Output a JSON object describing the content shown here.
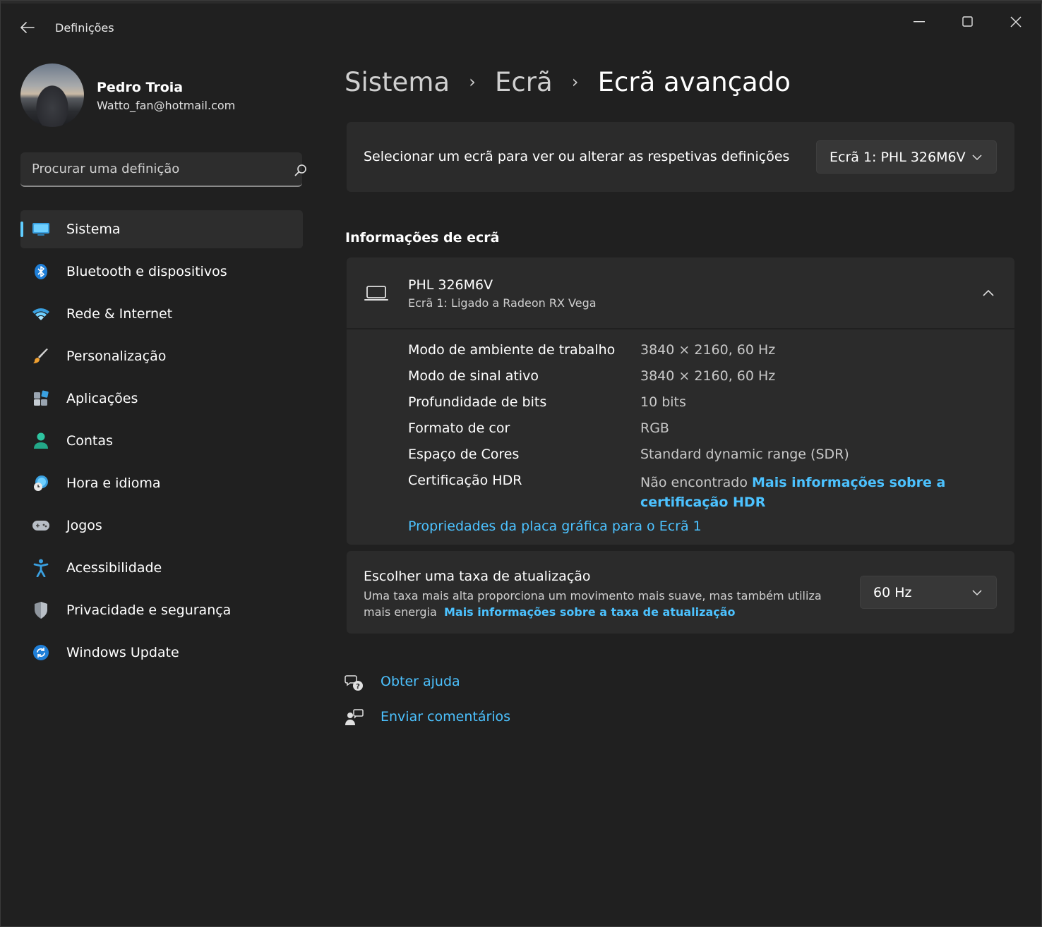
{
  "window": {
    "title": "Definições"
  },
  "profile": {
    "name": "Pedro Troia",
    "email": "Watto_fan@hotmail.com"
  },
  "search": {
    "placeholder": "Procurar uma definição"
  },
  "sidebar": {
    "items": [
      {
        "label": "Sistema",
        "icon": "monitor-icon",
        "active": true
      },
      {
        "label": "Bluetooth e dispositivos",
        "icon": "bluetooth-icon"
      },
      {
        "label": "Rede & Internet",
        "icon": "wifi-icon"
      },
      {
        "label": "Personalização",
        "icon": "brush-icon"
      },
      {
        "label": "Aplicações",
        "icon": "apps-icon"
      },
      {
        "label": "Contas",
        "icon": "person-icon"
      },
      {
        "label": "Hora e idioma",
        "icon": "clock-globe-icon"
      },
      {
        "label": "Jogos",
        "icon": "gamepad-icon"
      },
      {
        "label": "Acessibilidade",
        "icon": "accessibility-icon"
      },
      {
        "label": "Privacidade e segurança",
        "icon": "shield-icon"
      },
      {
        "label": "Windows Update",
        "icon": "update-icon"
      }
    ]
  },
  "breadcrumb": {
    "items": [
      "Sistema",
      "Ecrã",
      "Ecrã avançado"
    ],
    "separator": "›"
  },
  "screen_select": {
    "label": "Selecionar um ecrã para ver ou alterar as respetivas definições",
    "selected": "Ecrã 1: PHL 326M6V"
  },
  "display_info": {
    "section_title": "Informações de ecrã",
    "monitor_name": "PHL 326M6V",
    "monitor_sub": "Ecrã 1: Ligado a Radeon RX Vega",
    "rows": [
      {
        "key": "Modo de ambiente de trabalho",
        "value": "3840 × 2160, 60 Hz"
      },
      {
        "key": "Modo de sinal ativo",
        "value": "3840 × 2160, 60 Hz"
      },
      {
        "key": "Profundidade de bits",
        "value": "10 bits"
      },
      {
        "key": "Formato de cor",
        "value": "RGB"
      },
      {
        "key": "Espaço de Cores",
        "value": "Standard dynamic range (SDR)"
      }
    ],
    "hdr_key": "Certificação HDR",
    "hdr_value": "Não encontrado",
    "hdr_link": "Mais informações sobre a certificação HDR",
    "gpu_link": "Propriedades da placa gráfica para o Ecrã 1"
  },
  "refresh_rate": {
    "title": "Escolher uma taxa de atualização",
    "description": "Uma taxa mais alta proporciona um movimento mais suave, mas também utiliza mais energia",
    "link": "Mais informações sobre a taxa de atualização",
    "selected": "60 Hz"
  },
  "help": {
    "get_help": "Obter ajuda",
    "send_feedback": "Enviar comentários"
  },
  "colors": {
    "accent": "#60cdff",
    "link": "#4cc2ff",
    "background": "#202020",
    "card": "#2b2b2b"
  }
}
